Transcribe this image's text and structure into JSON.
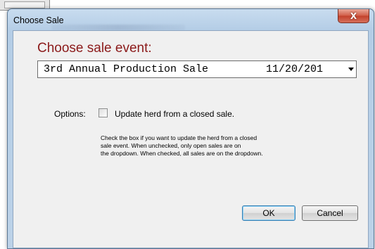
{
  "window": {
    "title": "Choose Sale",
    "close_glyph": "X"
  },
  "heading": "Choose sale event:",
  "sale_select": {
    "selected_name": "3rd Annual Production Sale",
    "selected_date": "11/20/201"
  },
  "options": {
    "label": "Options:",
    "checkbox_label": "Update herd from a closed sale.",
    "checked": false
  },
  "help_lines": [
    "Check the box if you want to update the herd from a closed",
    "sale event.  When unchecked, only open sales are on",
    "the dropdown. When checked, all sales are on the dropdown."
  ],
  "buttons": {
    "ok": "OK",
    "cancel": "Cancel"
  },
  "colors": {
    "heading": "#8b1a1a",
    "close_button": "#c2412b",
    "frame": "#b4cde6"
  },
  "icons": {
    "close": "close-icon",
    "dropdown": "chevron-down-icon"
  }
}
